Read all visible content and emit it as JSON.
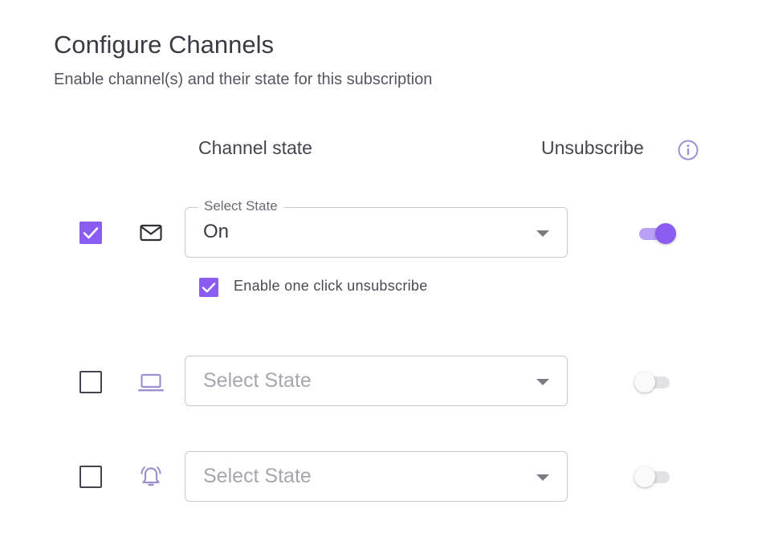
{
  "header": {
    "title": "Configure Channels",
    "subtitle": "Enable channel(s) and their state for this subscription"
  },
  "columns": {
    "channel_state": "Channel state",
    "unsubscribe": "Unsubscribe",
    "unsubscribe_info_icon": "info-icon"
  },
  "colors": {
    "accent": "#8a5cf0",
    "accent_light": "#b9a0f6",
    "muted_icon": "#9e8fcf"
  },
  "channels": [
    {
      "icon": "email-icon",
      "enabled": true,
      "state_label": "Select State",
      "state_value": "On",
      "one_click_unsubscribe": true,
      "one_click_label": "Enable one click unsubscribe",
      "unsubscribe_toggle": true
    },
    {
      "icon": "laptop-icon",
      "enabled": false,
      "state_placeholder": "Select State",
      "unsubscribe_toggle": false
    },
    {
      "icon": "bell-alert-icon",
      "enabled": false,
      "state_placeholder": "Select State",
      "unsubscribe_toggle": false
    }
  ]
}
